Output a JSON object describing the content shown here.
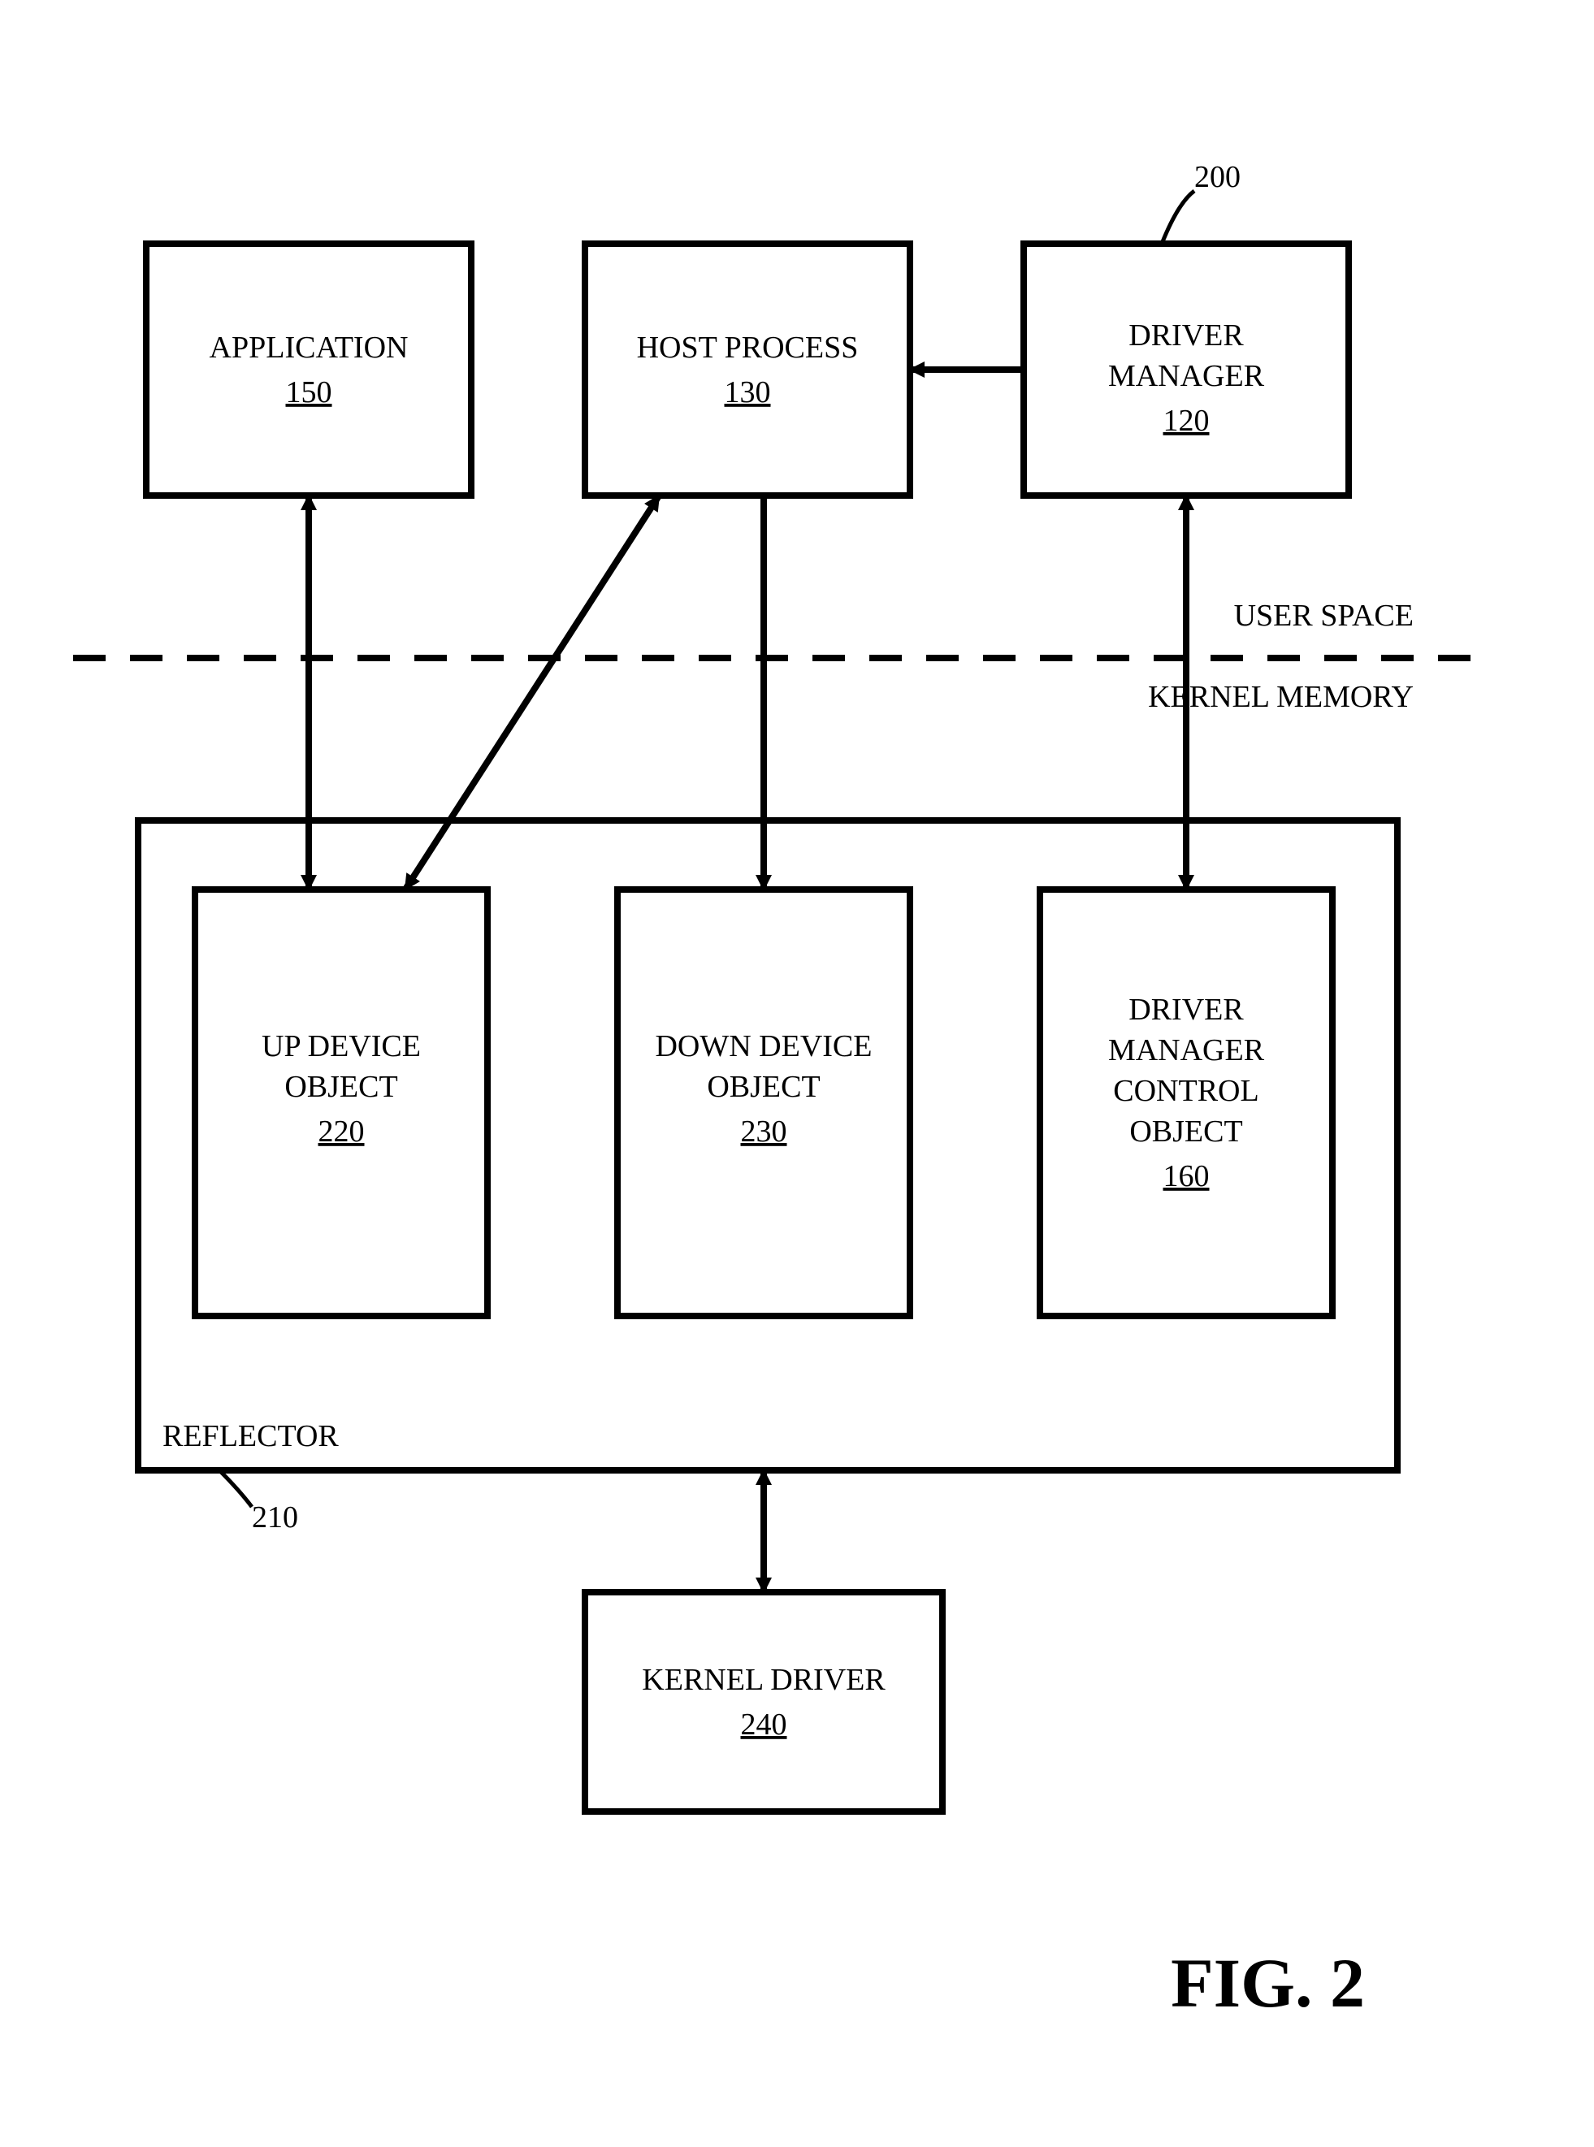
{
  "figure_label": "FIG. 2",
  "ref_marker": "200",
  "regions": {
    "user": "USER SPACE",
    "kernel": "KERNEL MEMORY"
  },
  "boxes": {
    "application": {
      "title": "APPLICATION",
      "ref": "150"
    },
    "host_process": {
      "title": "HOST PROCESS",
      "ref": "130"
    },
    "driver_manager": {
      "title_l1": "DRIVER",
      "title_l2": "MANAGER",
      "ref": "120"
    },
    "up_device": {
      "title_l1": "UP DEVICE",
      "title_l2": "OBJECT",
      "ref": "220"
    },
    "down_device": {
      "title_l1": "DOWN DEVICE",
      "title_l2": "OBJECT",
      "ref": "230"
    },
    "dmco": {
      "title_l1": "DRIVER",
      "title_l2": "MANAGER",
      "title_l3": "CONTROL",
      "title_l4": "OBJECT",
      "ref": "160"
    },
    "kernel_driver": {
      "title": "KERNEL DRIVER",
      "ref": "240"
    },
    "reflector": {
      "title": "REFLECTOR",
      "ref": "210"
    }
  },
  "chart_data": {
    "type": "diagram",
    "title": "FIG. 2",
    "nodes": [
      {
        "id": "application",
        "label": "APPLICATION 150",
        "region": "user_space"
      },
      {
        "id": "host_process",
        "label": "HOST PROCESS 130",
        "region": "user_space"
      },
      {
        "id": "driver_manager",
        "label": "DRIVER MANAGER 120",
        "region": "user_space"
      },
      {
        "id": "up_device",
        "label": "UP DEVICE OBJECT 220",
        "region": "kernel_memory",
        "parent": "reflector"
      },
      {
        "id": "down_device",
        "label": "DOWN DEVICE OBJECT 230",
        "region": "kernel_memory",
        "parent": "reflector"
      },
      {
        "id": "dmco",
        "label": "DRIVER MANAGER CONTROL OBJECT 160",
        "region": "kernel_memory",
        "parent": "reflector"
      },
      {
        "id": "reflector",
        "label": "REFLECTOR 210",
        "region": "kernel_memory"
      },
      {
        "id": "kernel_driver",
        "label": "KERNEL DRIVER 240",
        "region": "kernel_memory"
      }
    ],
    "edges": [
      {
        "from": "driver_manager",
        "to": "host_process",
        "type": "unidirectional"
      },
      {
        "from": "application",
        "to": "up_device",
        "type": "bidirectional"
      },
      {
        "from": "host_process",
        "to": "up_device",
        "type": "bidirectional"
      },
      {
        "from": "host_process",
        "to": "down_device",
        "type": "unidirectional"
      },
      {
        "from": "driver_manager",
        "to": "dmco",
        "type": "bidirectional"
      },
      {
        "from": "down_device",
        "to": "kernel_driver",
        "type": "bidirectional"
      }
    ],
    "regions": [
      "USER SPACE",
      "KERNEL MEMORY"
    ],
    "figure_ref": "200"
  }
}
